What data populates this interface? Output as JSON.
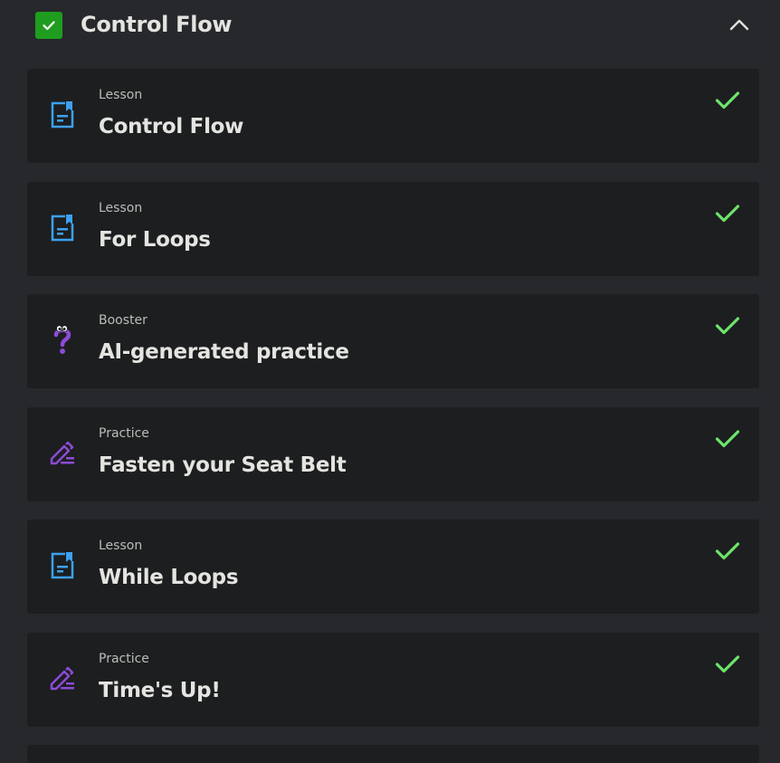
{
  "section": {
    "title": "Control Flow",
    "completed": true,
    "expanded": true,
    "icons": {
      "status": "checkbox-checked-icon",
      "toggle": "chevron-up-icon"
    },
    "colors": {
      "check_bg": "#1f9d1f"
    }
  },
  "items": [
    {
      "type": "Lesson",
      "title": "Control Flow",
      "icon": "lesson-document-icon",
      "completed": true
    },
    {
      "type": "Lesson",
      "title": "For Loops",
      "icon": "lesson-document-icon",
      "completed": true
    },
    {
      "type": "Booster",
      "title": "AI-generated practice",
      "icon": "question-mark-mascot-icon",
      "completed": true
    },
    {
      "type": "Practice",
      "title": "Fasten your Seat Belt",
      "icon": "pencil-edit-icon",
      "completed": true
    },
    {
      "type": "Lesson",
      "title": "While Loops",
      "icon": "lesson-document-icon",
      "completed": true
    },
    {
      "type": "Practice",
      "title": "Time's Up!",
      "icon": "pencil-edit-icon",
      "completed": true
    }
  ],
  "colors": {
    "background": "#26282b",
    "card": "#1c1e20",
    "lesson_icon": "#3da1f0",
    "practice_icon": "#8d4ad6",
    "completed_check": "#6ee36a"
  }
}
